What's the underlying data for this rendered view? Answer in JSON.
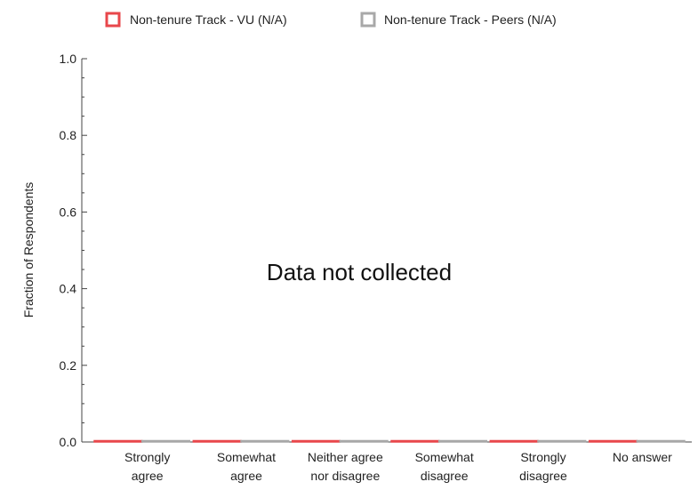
{
  "chart_data": {
    "type": "bar",
    "title": "",
    "xlabel": "",
    "ylabel": "Fraction of Respondents",
    "ylim": [
      0,
      1.0
    ],
    "yticks": [
      "0.0",
      "0.2",
      "0.4",
      "0.6",
      "0.8",
      "1.0"
    ],
    "categories": [
      [
        "Strongly",
        "agree"
      ],
      [
        "Somewhat",
        "agree"
      ],
      [
        "Neither agree",
        "nor disagree"
      ],
      [
        "Somewhat",
        "disagree"
      ],
      [
        "Strongly",
        "disagree"
      ],
      [
        "No answer"
      ]
    ],
    "series": [
      {
        "name": "Non-tenure Track - VU (N/A)",
        "values": [
          0,
          0,
          0,
          0,
          0,
          0
        ],
        "color": "#e8474b"
      },
      {
        "name": "Non-tenure Track - Peers (N/A)",
        "values": [
          0,
          0,
          0,
          0,
          0,
          0
        ],
        "color": "#a8a8a8"
      }
    ],
    "legend_position": "top",
    "grid": false,
    "annotation": "Data not collected"
  }
}
